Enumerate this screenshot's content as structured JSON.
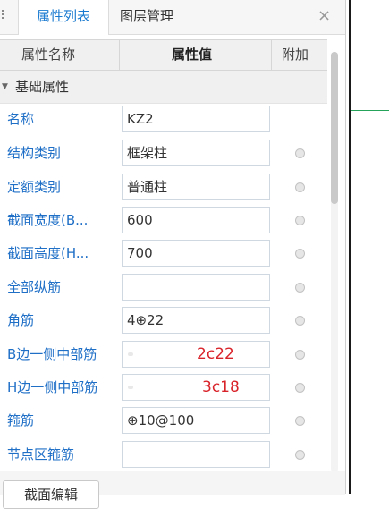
{
  "tabs": [
    {
      "label": "属性列表",
      "active": true
    },
    {
      "label": "图层管理",
      "active": false
    }
  ],
  "close_icon": "×",
  "table": {
    "headers": {
      "name": "属性名称",
      "value": "属性值",
      "extra": "附加"
    },
    "group_label": "基础属性",
    "rows": [
      {
        "label": "名称",
        "value": "KZ2",
        "has_checkbox": false
      },
      {
        "label": "结构类别",
        "value": "框架柱",
        "has_checkbox": true
      },
      {
        "label": "定额类别",
        "value": "普通柱",
        "has_checkbox": true
      },
      {
        "label": "截面宽度(B...",
        "value": "600",
        "has_checkbox": true
      },
      {
        "label": "截面高度(H...",
        "value": "700",
        "has_checkbox": true
      },
      {
        "label": "全部纵筋",
        "value": "",
        "has_checkbox": true
      },
      {
        "label": "角筋",
        "value": "4⊕22",
        "has_checkbox": true
      },
      {
        "label": "B边一侧中部筋",
        "value": "",
        "annotation": "2c22",
        "has_checkbox": true
      },
      {
        "label": "H边一侧中部筋",
        "value": "",
        "annotation": "3c18",
        "has_checkbox": true
      },
      {
        "label": "箍筋",
        "value": "⊕10@100",
        "has_checkbox": true
      },
      {
        "label": "节点区箍筋",
        "value": "",
        "has_checkbox": true
      }
    ]
  },
  "footer": {
    "button_label": "截面编辑"
  },
  "colors": {
    "accent": "#1a7ad0",
    "label": "#1f6fc7",
    "annotation": "#d9232a"
  }
}
